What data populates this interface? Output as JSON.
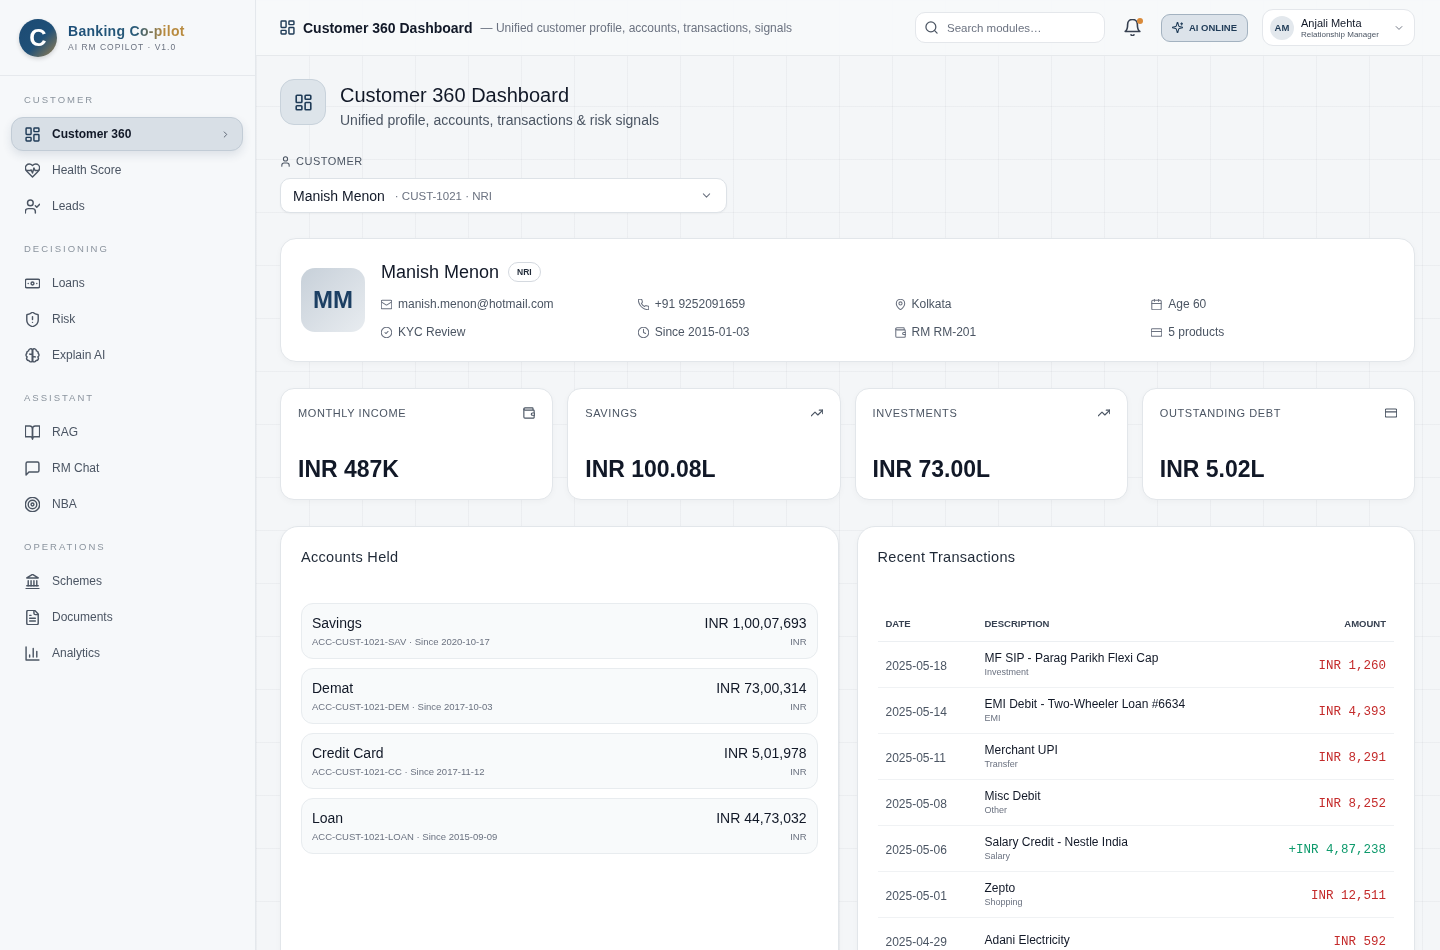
{
  "brand": {
    "logo_letter": "C",
    "name": "Banking Co-pilot",
    "tagline": "AI RM COPILOT · V1.0"
  },
  "sidebar": {
    "sections": [
      {
        "title": "CUSTOMER",
        "items": [
          {
            "label": "Customer 360",
            "selected": true
          },
          {
            "label": "Health Score",
            "selected": false
          },
          {
            "label": "Leads",
            "selected": false
          }
        ]
      },
      {
        "title": "DECISIONING",
        "items": [
          {
            "label": "Loans",
            "selected": false
          },
          {
            "label": "Risk",
            "selected": false
          },
          {
            "label": "Explain AI",
            "selected": false
          }
        ]
      },
      {
        "title": "ASSISTANT",
        "items": [
          {
            "label": "RAG",
            "selected": false
          },
          {
            "label": "RM Chat",
            "selected": false
          },
          {
            "label": "NBA",
            "selected": false
          }
        ]
      },
      {
        "title": "OPERATIONS",
        "items": [
          {
            "label": "Schemes",
            "selected": false
          },
          {
            "label": "Documents",
            "selected": false
          },
          {
            "label": "Analytics",
            "selected": false
          }
        ]
      }
    ]
  },
  "topbar": {
    "title": "Customer 360 Dashboard",
    "subtitle": "— Unified customer profile, accounts, transactions, signals",
    "search": {
      "placeholder": "Search modules…"
    },
    "notifications": {
      "unread": true
    },
    "ai_status": {
      "label": "AI ONLINE"
    },
    "user": {
      "initials": "AM",
      "name": "Anjali Mehta",
      "role": "Relationship Manager"
    }
  },
  "page_header": {
    "title": "Customer 360 Dashboard",
    "subtitle": "Unified profile, accounts, transactions & risk signals"
  },
  "customer_picker": {
    "label": "CUSTOMER",
    "name": "Manish Menon",
    "meta": "· CUST-1021 · NRI"
  },
  "profile": {
    "initials": "MM",
    "name": "Manish Menon",
    "tag": "NRI",
    "details": [
      "manish.menon@hotmail.com",
      "+91 9252091659",
      "Kolkata",
      "Age 60",
      "KYC Review",
      "Since 2015-01-03",
      "RM RM-201",
      "5 products"
    ]
  },
  "kpis": [
    {
      "label": "MONTHLY INCOME",
      "value": "INR 487K"
    },
    {
      "label": "SAVINGS",
      "value": "INR 100.08L"
    },
    {
      "label": "INVESTMENTS",
      "value": "INR 73.00L"
    },
    {
      "label": "OUTSTANDING DEBT",
      "value": "INR 5.02L"
    }
  ],
  "accounts": {
    "title": "Accounts Held",
    "items": [
      {
        "name": "Savings",
        "meta": "ACC-CUST-1021-SAV · Since 2020-10-17",
        "balance": "INR 1,00,07,693",
        "currency": "INR"
      },
      {
        "name": "Demat",
        "meta": "ACC-CUST-1021-DEM · Since 2017-10-03",
        "balance": "INR 73,00,314",
        "currency": "INR"
      },
      {
        "name": "Credit Card",
        "meta": "ACC-CUST-1021-CC · Since 2017-11-12",
        "balance": "INR 5,01,978",
        "currency": "INR"
      },
      {
        "name": "Loan",
        "meta": "ACC-CUST-1021-LOAN · Since 2015-09-09",
        "balance": "INR 44,73,032",
        "currency": "INR"
      }
    ]
  },
  "transactions": {
    "title": "Recent Transactions",
    "columns": [
      "DATE",
      "DESCRIPTION",
      "AMOUNT"
    ],
    "rows": [
      {
        "date": "2025-05-18",
        "description": "MF SIP - Parag Parikh Flexi Cap",
        "category": "Investment",
        "amount": "INR 1,260",
        "kind": "debit"
      },
      {
        "date": "2025-05-14",
        "description": "EMI Debit - Two-Wheeler Loan #6634",
        "category": "EMI",
        "amount": "INR 4,393",
        "kind": "debit"
      },
      {
        "date": "2025-05-11",
        "description": "Merchant UPI",
        "category": "Transfer",
        "amount": "INR 8,291",
        "kind": "debit"
      },
      {
        "date": "2025-05-08",
        "description": "Misc Debit",
        "category": "Other",
        "amount": "INR 8,252",
        "kind": "debit"
      },
      {
        "date": "2025-05-06",
        "description": "Salary Credit - Nestle India",
        "category": "Salary",
        "amount": "+INR 4,87,238",
        "kind": "credit"
      },
      {
        "date": "2025-05-01",
        "description": "Zepto",
        "category": "Shopping",
        "amount": "INR 12,511",
        "kind": "debit"
      },
      {
        "date": "2025-04-29",
        "description": "Adani Electricity",
        "amount": "INR 592",
        "kind": "debit"
      }
    ]
  }
}
